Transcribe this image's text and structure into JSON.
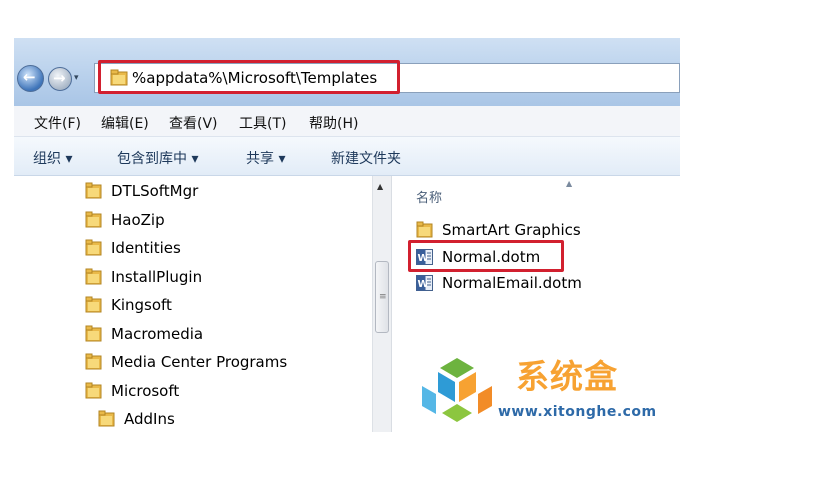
{
  "address": {
    "path": "%appdata%\\Microsoft\\Templates"
  },
  "menubar": [
    "文件(F)",
    "编辑(E)",
    "查看(V)",
    "工具(T)",
    "帮助(H)"
  ],
  "toolbar": {
    "organize": "组织 ▾",
    "include_in_library": "包含到库中 ▾",
    "share": "共享 ▾",
    "new_folder": "新建文件夹"
  },
  "tree": [
    "DTLSoftMgr",
    "HaoZip",
    "Identities",
    "InstallPlugin",
    "Kingsoft",
    "Macromedia",
    "Media Center Programs",
    "Microsoft",
    "AddIns"
  ],
  "files": {
    "column_name": "名称",
    "items": [
      {
        "name": "SmartArt Graphics",
        "icon": "folder-icon"
      },
      {
        "name": "Normal.dotm",
        "icon": "word-document-icon"
      },
      {
        "name": "NormalEmail.dotm",
        "icon": "word-document-icon"
      }
    ]
  },
  "watermark": {
    "brand": "系统盒",
    "url": "www.xitonghe.com"
  },
  "colors": {
    "highlight": "#d2202f",
    "folder": "#e9b949",
    "watermark_orange": "#f7a232",
    "watermark_blue": "#2e6aa8"
  }
}
